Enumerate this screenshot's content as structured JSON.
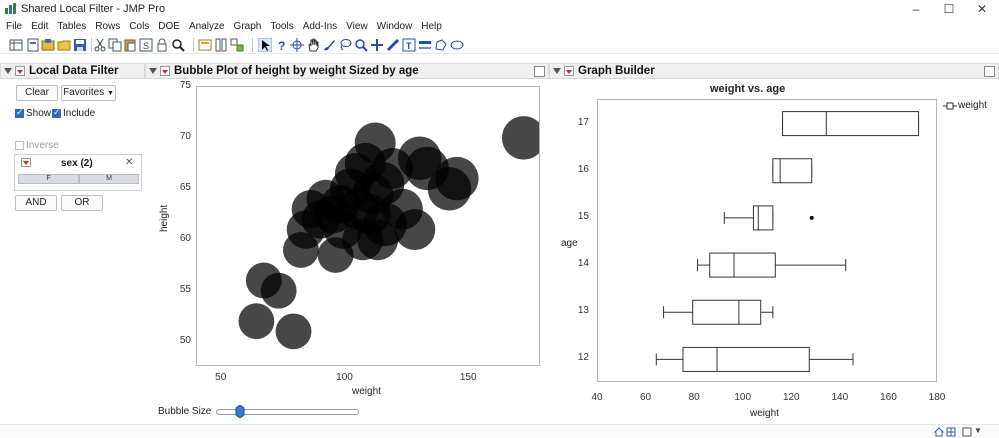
{
  "window": {
    "title": "Shared Local Filter - JMP Pro",
    "minimize_glyph": "–",
    "maximize_glyph": "☐",
    "close_glyph": "✕"
  },
  "menu": [
    "File",
    "Edit",
    "Tables",
    "Rows",
    "Cols",
    "DOE",
    "Analyze",
    "Graph",
    "Tools",
    "Add-Ins",
    "View",
    "Window",
    "Help"
  ],
  "toolbar_icons": [
    "new-table-icon",
    "open-icon",
    "import-icon",
    "folder-icon",
    "save-icon",
    "cut-icon",
    "copy-icon",
    "paste-icon",
    "journal-icon",
    "lock-icon",
    "search-icon",
    "layout-icon",
    "script-icon",
    "reorder-icon",
    "arrow-icon",
    "help-icon",
    "crosshair-icon",
    "hand-icon",
    "brush-icon",
    "lasso-icon",
    "magnifier-icon",
    "plus-icon",
    "ruler-icon",
    "annotate-icon",
    "line-icon",
    "polygon-icon",
    "ellipse-icon"
  ],
  "filter": {
    "title": "Local Data Filter",
    "clear_label": "Clear",
    "favorites_label": "Favorites",
    "show_label": "Show",
    "include_label": "Include",
    "inverse_label": "Inverse",
    "show_checked": true,
    "include_checked": true,
    "inverse_checked": false,
    "column_title": "sex (2)",
    "close_glyph": "✕",
    "levels": [
      "F",
      "M"
    ],
    "and_label": "AND",
    "or_label": "OR"
  },
  "bubble": {
    "title": "Bubble Plot of height by weight Sized by age",
    "slider_label": "Bubble Size",
    "slider_value": 0.17
  },
  "gb": {
    "title": "Graph Builder"
  },
  "chart_data": [
    {
      "type": "scatter",
      "title": "",
      "xlabel": "weight",
      "ylabel": "height",
      "xlim": [
        40,
        179
      ],
      "ylim": [
        47.5,
        75
      ],
      "xticks": [
        50,
        100,
        150
      ],
      "yticks": [
        50,
        55,
        60,
        65,
        70,
        75
      ],
      "bubble_color": "#000000",
      "points": [
        {
          "x": 172,
          "y": 70,
          "size": 17
        },
        {
          "x": 64,
          "y": 52,
          "size": 14
        },
        {
          "x": 79,
          "y": 51,
          "size": 14
        },
        {
          "x": 67,
          "y": 56,
          "size": 14
        },
        {
          "x": 73,
          "y": 55,
          "size": 14
        },
        {
          "x": 82,
          "y": 59,
          "size": 14
        },
        {
          "x": 96,
          "y": 58.5,
          "size": 14
        },
        {
          "x": 84,
          "y": 61,
          "size": 15
        },
        {
          "x": 86,
          "y": 63,
          "size": 15
        },
        {
          "x": 90,
          "y": 62,
          "size": 15
        },
        {
          "x": 92,
          "y": 64,
          "size": 15
        },
        {
          "x": 95,
          "y": 62.5,
          "size": 15
        },
        {
          "x": 98,
          "y": 63.5,
          "size": 15
        },
        {
          "x": 99,
          "y": 61,
          "size": 15
        },
        {
          "x": 102,
          "y": 65,
          "size": 16
        },
        {
          "x": 104,
          "y": 66.5,
          "size": 16
        },
        {
          "x": 105,
          "y": 63,
          "size": 16
        },
        {
          "x": 107,
          "y": 60,
          "size": 16
        },
        {
          "x": 108,
          "y": 67.5,
          "size": 16
        },
        {
          "x": 110,
          "y": 62.5,
          "size": 16
        },
        {
          "x": 111,
          "y": 64.5,
          "size": 16
        },
        {
          "x": 112,
          "y": 69.5,
          "size": 16
        },
        {
          "x": 113,
          "y": 60,
          "size": 16
        },
        {
          "x": 115,
          "y": 65.5,
          "size": 17
        },
        {
          "x": 116,
          "y": 61.5,
          "size": 17
        },
        {
          "x": 119,
          "y": 67,
          "size": 16
        },
        {
          "x": 123,
          "y": 63,
          "size": 16
        },
        {
          "x": 128,
          "y": 61,
          "size": 16
        },
        {
          "x": 130,
          "y": 68,
          "size": 17
        },
        {
          "x": 133,
          "y": 67,
          "size": 17
        },
        {
          "x": 142,
          "y": 65,
          "size": 17
        },
        {
          "x": 145,
          "y": 66,
          "size": 17
        }
      ]
    },
    {
      "type": "box",
      "title": "weight vs. age",
      "xlabel": "weight",
      "ylabel": "age",
      "xlim": [
        40,
        180
      ],
      "xticks": [
        40,
        60,
        80,
        100,
        120,
        140,
        160,
        180
      ],
      "legend": [
        "weight"
      ],
      "legend_position": "right",
      "categories": [
        "12",
        "13",
        "14",
        "15",
        "16",
        "17"
      ],
      "boxes": [
        {
          "category": "12",
          "min": 64,
          "q1": 75,
          "median": 89,
          "q3": 127,
          "max": 145
        },
        {
          "category": "13",
          "min": 67,
          "q1": 79,
          "median": 98,
          "q3": 107,
          "max": 112
        },
        {
          "category": "14",
          "min": 81,
          "q1": 86,
          "median": 96,
          "q3": 113,
          "max": 142
        },
        {
          "category": "15",
          "min": 92,
          "q1": 104,
          "median": 106,
          "q3": 112,
          "max": 112
        },
        {
          "category": "16",
          "min": 112,
          "q1": 112,
          "median": 115,
          "q3": 128,
          "max": 128
        },
        {
          "category": "17",
          "min": 116,
          "q1": 116,
          "median": 134,
          "q3": 172,
          "max": 172
        }
      ],
      "outliers": [
        {
          "category": "15",
          "x": 128
        }
      ]
    }
  ]
}
